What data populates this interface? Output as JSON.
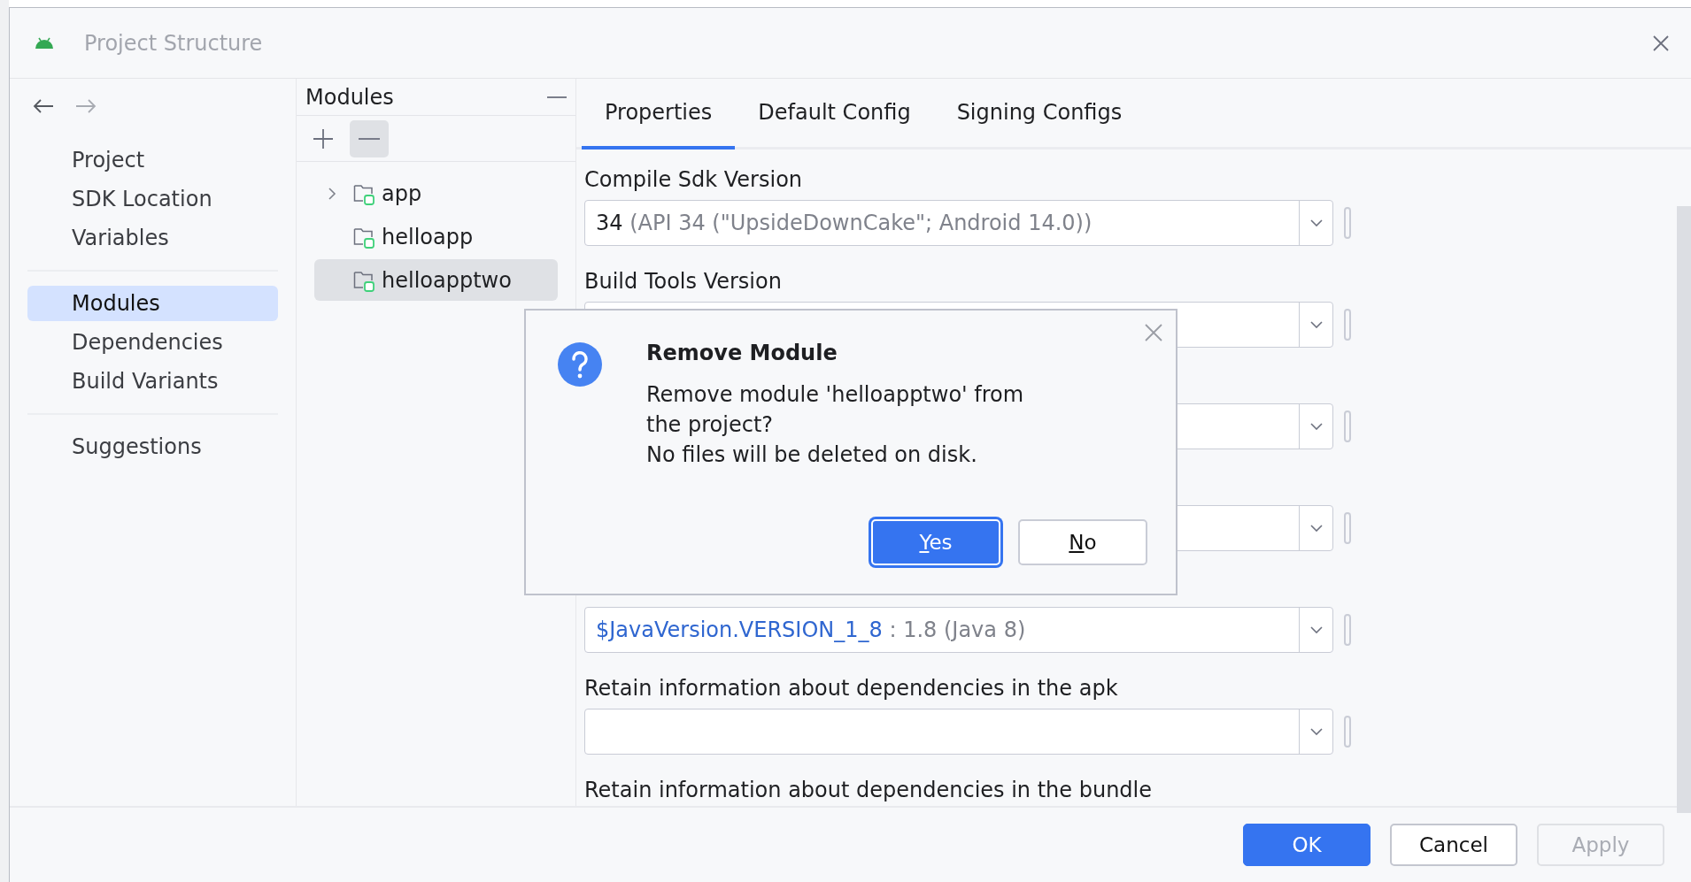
{
  "window": {
    "title": "Project Structure"
  },
  "nav_groups": [
    [
      {
        "label": "Project",
        "selected": false
      },
      {
        "label": "SDK Location",
        "selected": false
      },
      {
        "label": "Variables",
        "selected": false
      }
    ],
    [
      {
        "label": "Modules",
        "selected": true
      },
      {
        "label": "Dependencies",
        "selected": false
      },
      {
        "label": "Build Variants",
        "selected": false
      }
    ],
    [
      {
        "label": "Suggestions",
        "selected": false
      }
    ]
  ],
  "modules": {
    "title": "Modules",
    "items": [
      {
        "label": "app",
        "expandable": true,
        "selected": false
      },
      {
        "label": "helloapp",
        "expandable": false,
        "selected": false
      },
      {
        "label": "helloapptwo",
        "expandable": false,
        "selected": true
      }
    ]
  },
  "tabs": [
    {
      "label": "Properties",
      "selected": true
    },
    {
      "label": "Default Config",
      "selected": false
    },
    {
      "label": "Signing Configs",
      "selected": false
    }
  ],
  "fields": [
    {
      "kind": "dropdown",
      "label": "Compile Sdk Version",
      "value": "34",
      "variable": false,
      "detail": " (API 34 (\"UpsideDownCake\"; Android 14.0))"
    },
    {
      "kind": "dropdown",
      "label": "Build Tools Version"
    },
    {
      "kind": "dropdown"
    },
    {
      "kind": "dropdown"
    },
    {
      "kind": "dropdown",
      "value": "$JavaVersion.VERSION_1_8",
      "variable": true,
      "detail": " : 1.8 (Java 8)"
    },
    {
      "kind": "dropdown",
      "label": "Retain information about dependencies in the apk"
    },
    {
      "kind": "cut-off",
      "label": "Retain information about dependencies in the bundle"
    }
  ],
  "buttons": [
    {
      "label": "OK",
      "kind": "primary"
    },
    {
      "label": "Cancel",
      "kind": "secondary"
    },
    {
      "label": "Apply",
      "kind": "disabled"
    }
  ],
  "dialog": {
    "title": "Remove Module",
    "message": [
      "Remove module 'helloapptwo' from the project?",
      "No files will be deleted on disk."
    ],
    "buttons": [
      {
        "label": "Yes",
        "default": true,
        "mnemonic": true
      },
      {
        "label": "No",
        "default": false,
        "mnemonic": true
      }
    ]
  }
}
